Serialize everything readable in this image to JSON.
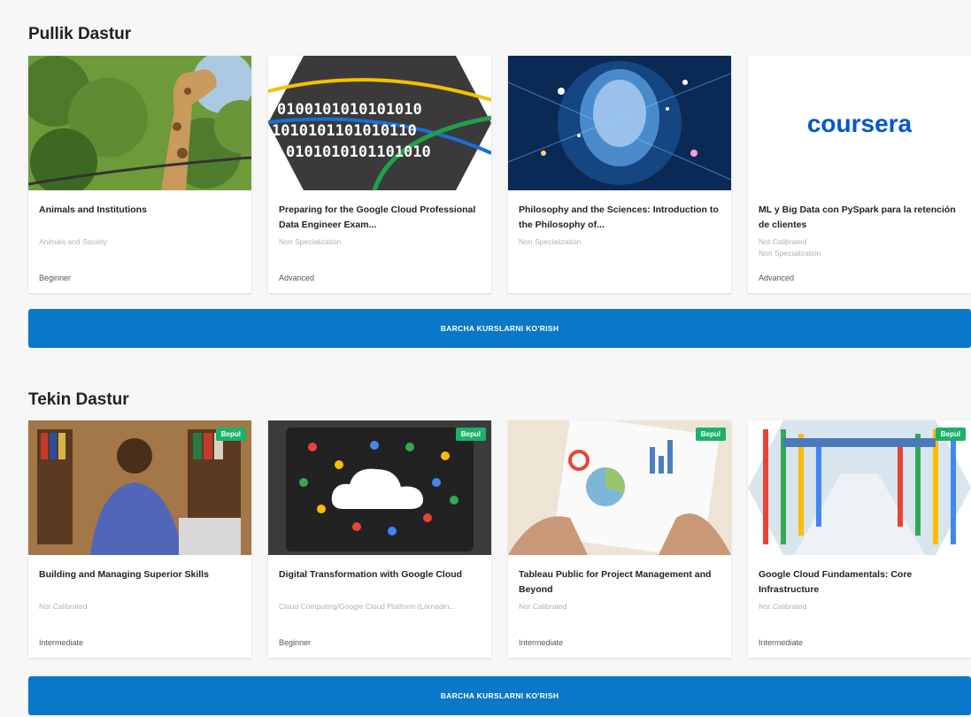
{
  "sections": [
    {
      "title": "Pullik Dastur",
      "cta": "BARCHA KURSLARNI KO'RISH",
      "courses": [
        {
          "title": "Animals and Institutions",
          "subtitle": [
            "Animals and Society"
          ],
          "level": "Beginner",
          "badge": "",
          "image": "giraffe-photo"
        },
        {
          "title": "Preparing for the Google Cloud Professional Data Engineer Exam...",
          "subtitle": [
            "Non Specialization"
          ],
          "level": "Advanced",
          "badge": "",
          "image": "binary-code-graphic"
        },
        {
          "title": "Philosophy and the Sciences: Introduction to the Philosophy of...",
          "subtitle": [
            "Non Specialization"
          ],
          "level": "",
          "badge": "",
          "image": "glowing-brain-graphic"
        },
        {
          "title": "ML y Big Data con PySpark para la retención de clientes",
          "subtitle": [
            "Not Calibrated",
            "Non Specialization"
          ],
          "level": "Advanced",
          "badge": "",
          "image": "coursera-logo",
          "logo_text": "coursera"
        }
      ]
    },
    {
      "title": "Tekin Dastur",
      "cta": "BARCHA KURSLARNI KO'RISH",
      "courses": [
        {
          "title": "Building and Managing Superior Skills",
          "subtitle": [
            "Not Calibrated"
          ],
          "level": "Intermediate",
          "badge": "Bepul",
          "image": "man-with-laptop-photo"
        },
        {
          "title": "Digital Transformation with Google Cloud",
          "subtitle": [
            "Cloud Computing/Google Cloud Platform (Larnadin..."
          ],
          "level": "Beginner",
          "badge": "Bepul",
          "image": "cloud-graphic"
        },
        {
          "title": "Tableau Public for Project Management and Beyond",
          "subtitle": [
            "Not Calibrated"
          ],
          "level": "Intermediate",
          "badge": "Bepul",
          "image": "charts-paper-photo"
        },
        {
          "title": "Google Cloud Fundamentals: Core Infrastructure",
          "subtitle": [
            "Not Calibrated"
          ],
          "level": "Intermediate",
          "badge": "Bepul",
          "image": "data-center-photo"
        }
      ]
    }
  ],
  "colors": {
    "accent": "#0a78c8",
    "badge": "#1bb26b",
    "coursera": "#0056d2"
  }
}
